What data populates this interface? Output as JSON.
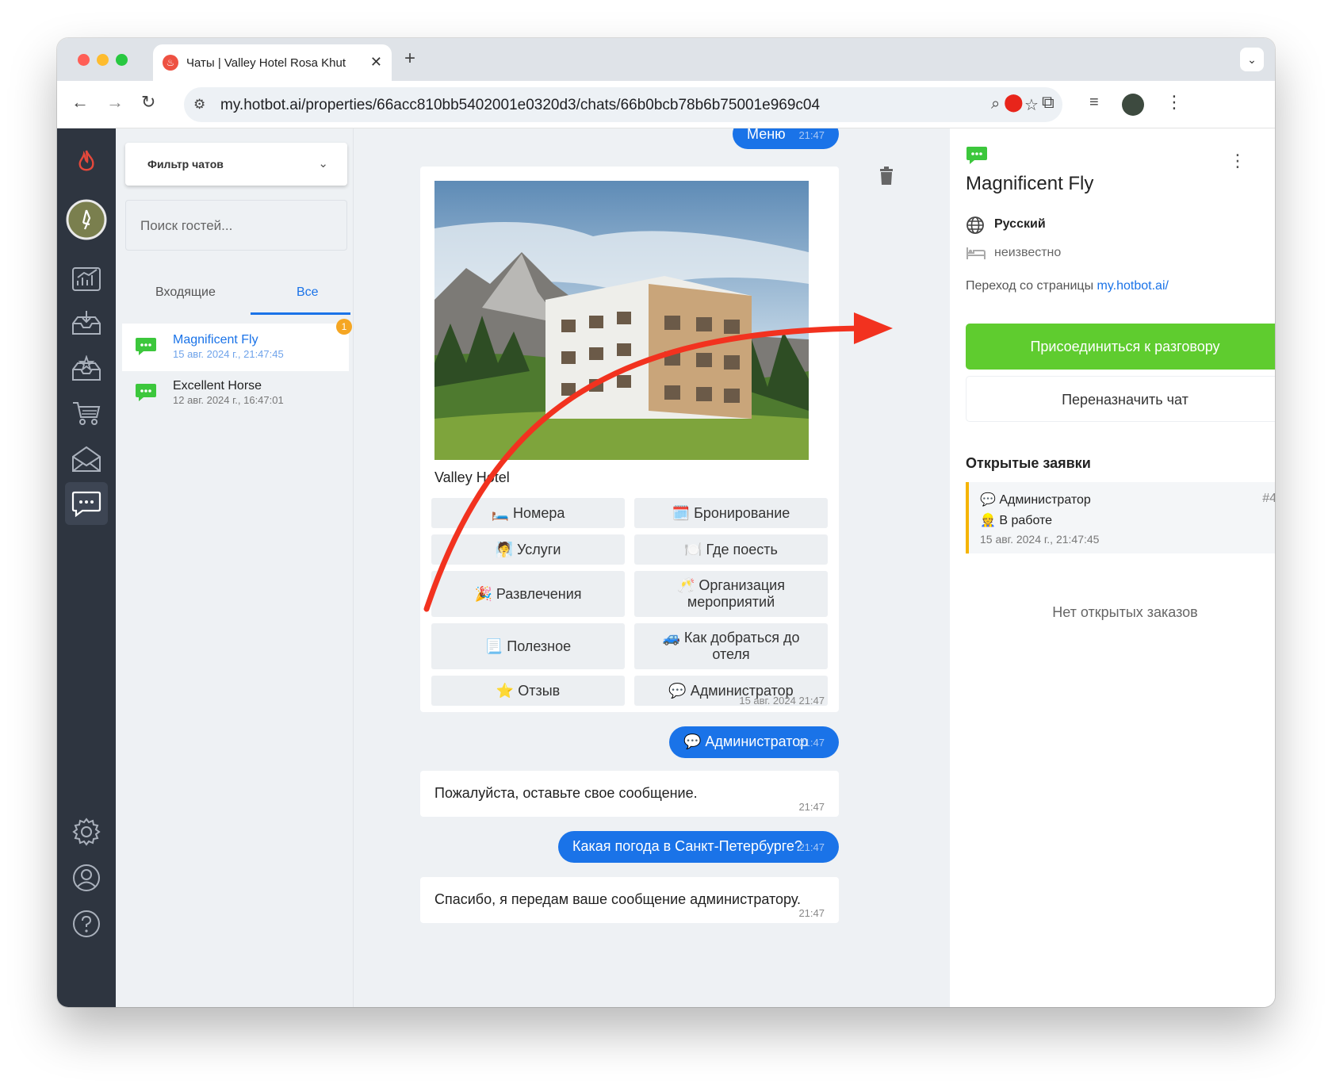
{
  "browser": {
    "tab_title": "Чаты | Valley Hotel Rosa Khut",
    "tab_favicon": "hotbot-flame-icon",
    "url": "my.hotbot.ai/properties/66acc810bb5402001e0320d3/chats/66b0bcb78b6b75001e969c04",
    "colors": {
      "close": "#ff5f57",
      "minimize": "#febc2e",
      "maximize": "#28c840"
    }
  },
  "rail": {
    "items": [
      "hotbot-logo",
      "avatar",
      "analytics-icon",
      "inbox-icon",
      "reviews-icon",
      "cart-icon",
      "mail-icon",
      "chat-icon",
      "settings-icon",
      "profile-icon",
      "help-icon"
    ],
    "active": "chat-icon"
  },
  "chatlist": {
    "filter_label": "Фильтр чатов",
    "search_placeholder": "Поиск гостей...",
    "tabs": [
      "Входящие",
      "Все"
    ],
    "active_tab": "Все",
    "chats": [
      {
        "name": "Magnificent Fly",
        "date": "15 авг. 2024 г., 21:47:45",
        "unread": "1",
        "active": true
      },
      {
        "name": "Excellent Horse",
        "date": "12 авг. 2024 г., 16:47:01",
        "unread": "",
        "active": false
      }
    ]
  },
  "conversation": {
    "menu_msg": {
      "text": "Меню",
      "time": "21:47"
    },
    "card": {
      "hotel_name": "Valley Hotel",
      "buttons": [
        "🛏️ Номера",
        "🗓️ Бронирование",
        "🧖 Услуги",
        "🍽️ Где поесть",
        "🎉 Развлечения",
        "🥂 Организация мероприятий",
        "📃 Полезное",
        "🚙 Как добраться до отеля",
        "⭐ Отзыв",
        "💬 Администратор"
      ],
      "time": "15 авг. 2024 21:47"
    },
    "admin_msg": {
      "text": "💬 Администратор",
      "time": "21:47"
    },
    "bot_reply_1": {
      "text": "Пожалуйста, оставьте свое сообщение.",
      "time": "21:47"
    },
    "weather_msg": {
      "text": "Какая погода в Санкт-Петербурге?",
      "time": "21:47"
    },
    "bot_reply_2": {
      "text": "Спасибо, я передам ваше сообщение администратору.",
      "time": "21:47"
    }
  },
  "side": {
    "guest_name": "Magnificent Fly",
    "language": "Русский",
    "room": "неизвестно",
    "source_prefix": "Переход со страницы",
    "source_link": "my.hotbot.ai/",
    "join_button": "Присоединиться к разговору",
    "reassign_button": "Переназначить чат",
    "open_requests_title": "Открытые заявки",
    "ticket": {
      "name": "💬 Администратор",
      "number": "#4",
      "status": "👷 В работе",
      "date": "15 авг. 2024 г., 21:47:45"
    },
    "no_orders": "Нет открытых заказов"
  },
  "colors": {
    "accent": "#1a73e8",
    "join_green": "#5fcc2f",
    "chat_icon_green": "#3cc73c",
    "rail_bg": "#2e3540",
    "annotation_arrow": "#f2321f"
  }
}
